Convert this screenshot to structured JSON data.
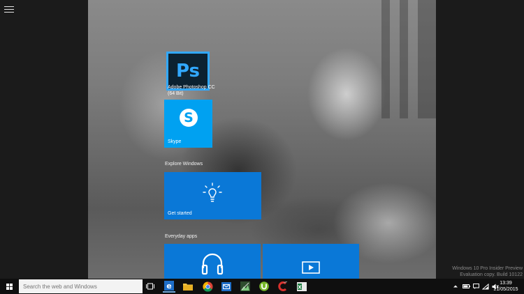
{
  "start_menu": {
    "menu_icon": "hamburger-icon",
    "tiles": {
      "photoshop": {
        "label": "Adobe Photoshop CC (64 Bit)",
        "logo_text": "Ps",
        "color": "#31a8ff"
      },
      "skype": {
        "label": "Skype",
        "logo_text": "S",
        "color": "#00a1f1"
      },
      "get_started": {
        "label": "Get started",
        "icon": "lightbulb-icon",
        "color": "#0a78d7"
      },
      "music": {
        "label": "",
        "icon": "headphones-icon"
      },
      "video": {
        "label": "",
        "icon": "video-play-icon"
      }
    },
    "groups": {
      "explore": "Explore Windows",
      "everyday": "Everyday apps"
    }
  },
  "watermark": {
    "line1": "Windows 10 Pro Insider Preview",
    "line2": "Evaluation copy. Build 10122"
  },
  "taskbar": {
    "search_placeholder": "Search the web and Windows",
    "apps": [
      "task-view-icon",
      "ie-icon",
      "file-explorer-icon",
      "chrome-icon",
      "mail-icon",
      "photos-icon",
      "utorrent-icon",
      "ccleaner-icon",
      "excel-icon"
    ],
    "clock": {
      "time": "13:39",
      "date": "21/05/2015"
    }
  }
}
